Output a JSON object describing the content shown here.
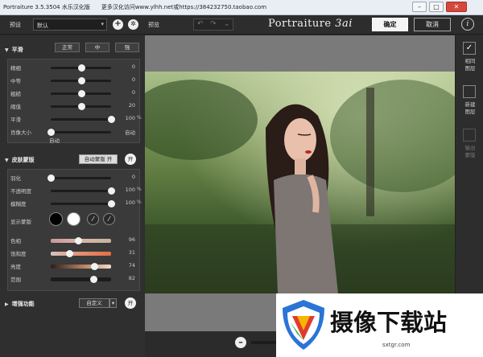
{
  "window": {
    "title": "Portraiture 3.5.3504 水乐汉化版　　更多汉化访问www.ylhh.net或https://384232750.taobao.com",
    "min": "–",
    "max": "□",
    "close": "✕"
  },
  "toolbar": {
    "preset_label": "预设",
    "preset_value": "默认",
    "preview_label": "预览",
    "undo": "↶",
    "redo": "↷",
    "history": "⌄",
    "app_name": "Portraiture",
    "app_ver": "3ai",
    "ok": "确定",
    "cancel": "取消",
    "info": "i"
  },
  "smoothing": {
    "title": "平滑",
    "modes": [
      "正常",
      "中",
      "强"
    ],
    "sliders": [
      {
        "label": "精细",
        "value": "0",
        "unit": "",
        "pos": 0.5
      },
      {
        "label": "中等",
        "value": "0",
        "unit": "",
        "pos": 0.5
      },
      {
        "label": "粗糙",
        "value": "0",
        "unit": "",
        "pos": 0.5
      },
      {
        "label": "阈值",
        "value": "20",
        "unit": "",
        "pos": 0.5
      },
      {
        "label": "平滑",
        "value": "100",
        "unit": "%",
        "pos": 1.0
      },
      {
        "label": "肖像大小",
        "value": "自动",
        "unit": "",
        "pos": 0.0
      }
    ],
    "auto_label": "自动"
  },
  "skin": {
    "title": "皮肤蒙版",
    "auto_mask": "自动蒙版 开",
    "toggle": "开",
    "sliders": [
      {
        "label": "羽化",
        "value": "0",
        "unit": "",
        "pos": 0.0
      },
      {
        "label": "不透明度",
        "value": "100",
        "unit": "%",
        "pos": 1.0
      },
      {
        "label": "模糊度",
        "value": "100",
        "unit": "%",
        "pos": 1.0
      }
    ],
    "show_mask": "显示蒙版",
    "colors": [
      {
        "label": "色相",
        "value": "96",
        "pos": 0.45,
        "grad": "linear-gradient(90deg,#c9999a,#d9b5a9,#c8b59a)"
      },
      {
        "label": "饱和度",
        "value": "31",
        "pos": 0.3,
        "grad": "linear-gradient(90deg,#d8c2bd,#e38f73,#e76e42)"
      },
      {
        "label": "亮度",
        "value": "74",
        "pos": 0.72,
        "grad": "linear-gradient(90deg,#2a1f1a,#b07a5a,#f3ddc8)"
      },
      {
        "label": "范围",
        "value": "82",
        "pos": 0.7,
        "grad": "#1c1c1c"
      }
    ]
  },
  "enhance": {
    "title": "增强功能",
    "select": "自定义",
    "toggle": "开"
  },
  "right": {
    "items": [
      {
        "label": "相同\n图层",
        "check": "✓"
      },
      {
        "label": "新建\n图层",
        "check": ""
      },
      {
        "label": "输出\n蒙版",
        "check": ""
      }
    ]
  },
  "zoom": {
    "minus": "–"
  },
  "watermark": {
    "text": "摄像下载站",
    "url": "sxtgr.com"
  }
}
